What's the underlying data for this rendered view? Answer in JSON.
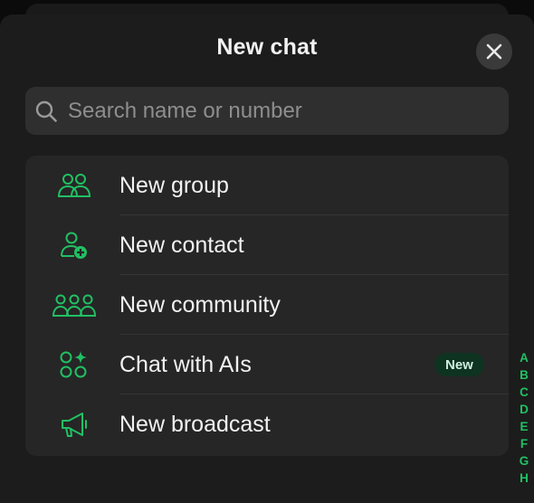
{
  "header": {
    "title": "New chat"
  },
  "search": {
    "placeholder": "Search name or number",
    "value": ""
  },
  "menu": {
    "items": [
      {
        "label": "New group",
        "icon": "group-icon"
      },
      {
        "label": "New contact",
        "icon": "add-contact-icon"
      },
      {
        "label": "New community",
        "icon": "community-icon"
      },
      {
        "label": "Chat with AIs",
        "icon": "ai-chat-icon",
        "badge": "New"
      },
      {
        "label": "New broadcast",
        "icon": "megaphone-icon"
      }
    ]
  },
  "alphabet_index": [
    "A",
    "B",
    "C",
    "D",
    "E",
    "F",
    "G",
    "H"
  ],
  "colors": {
    "accent": "#21c063",
    "background": "#1c1c1c",
    "menu_background": "#262626",
    "search_background": "#2f2f2f",
    "badge_background": "#0e3320"
  }
}
